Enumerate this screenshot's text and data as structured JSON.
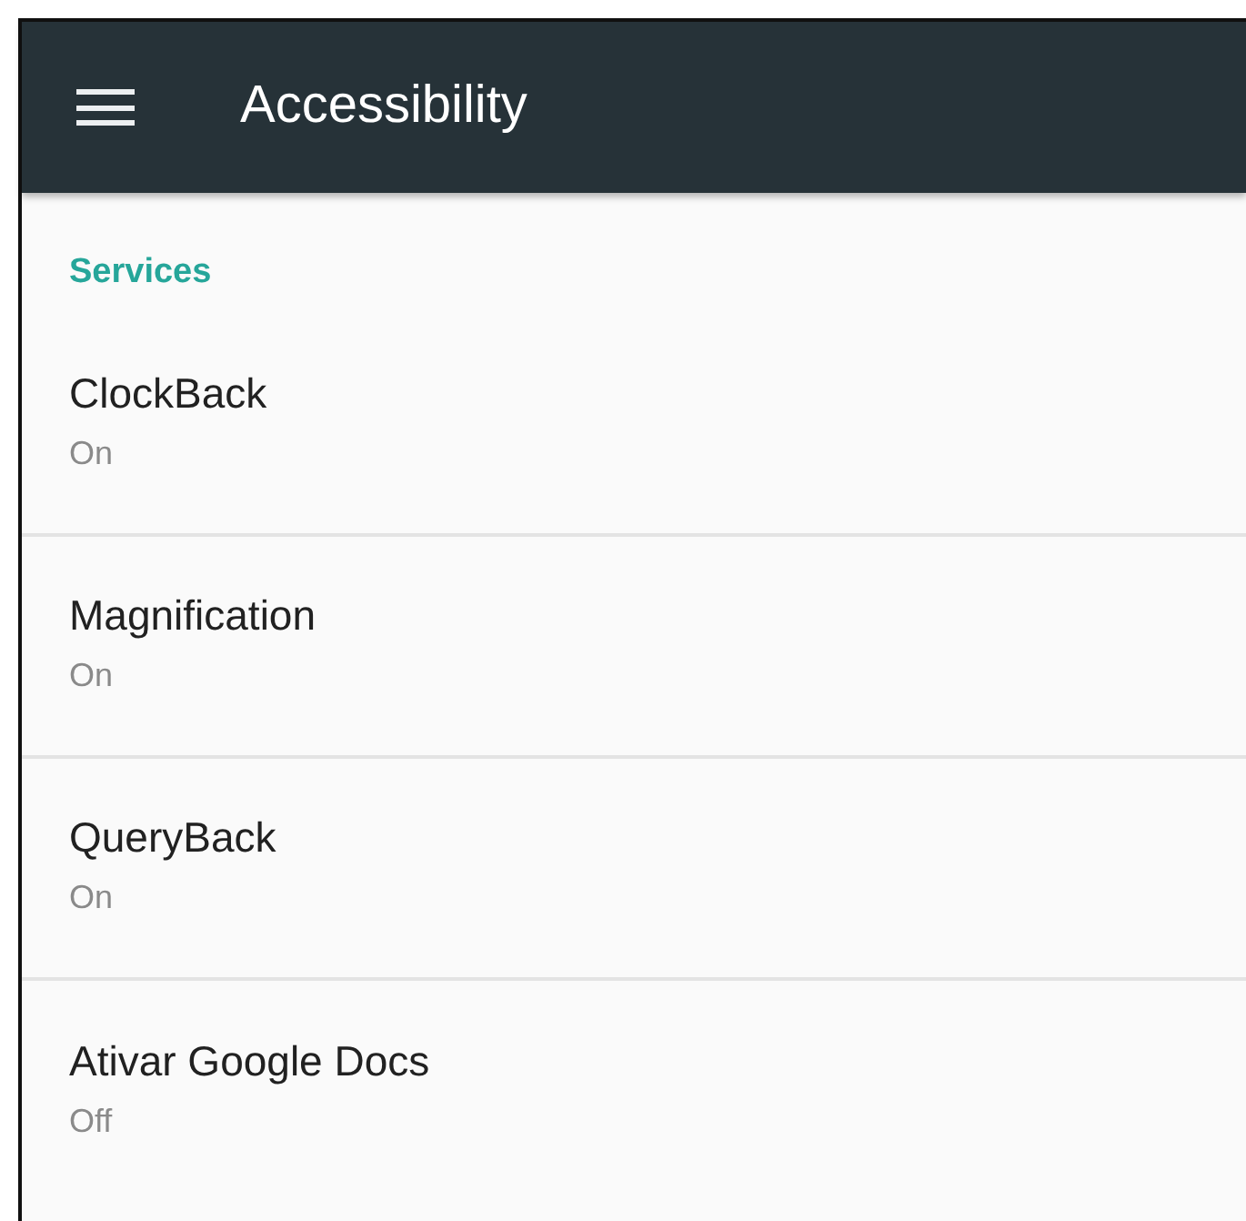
{
  "app_bar": {
    "title": "Accessibility"
  },
  "section": {
    "title": "Services"
  },
  "items": [
    {
      "title": "ClockBack",
      "status": "On"
    },
    {
      "title": "Magnification",
      "status": "On"
    },
    {
      "title": "QueryBack",
      "status": "On"
    },
    {
      "title": "Ativar Google Docs",
      "status": "Off"
    }
  ]
}
